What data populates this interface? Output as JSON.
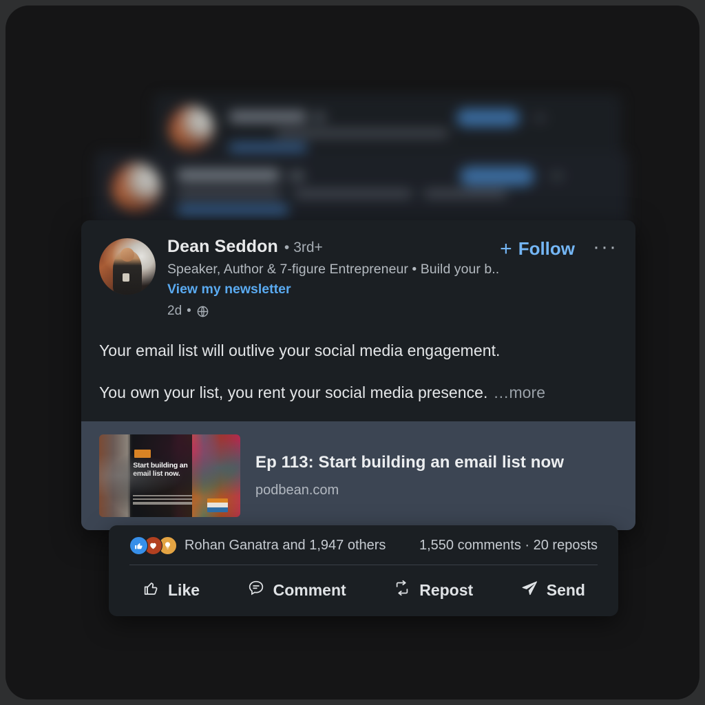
{
  "post": {
    "author": {
      "name": "Dean Seddon",
      "separator": "•",
      "degree": "3rd+",
      "headline": "Speaker, Author & 7-figure Entrepreneur • Build your b...",
      "newsletter_link": "View my newsletter",
      "timestamp": "2d",
      "meta_separator": "•",
      "visibility_icon": "globe-icon",
      "avatar_icon": "avatar"
    },
    "follow_button": {
      "plus": "+",
      "label": "Follow"
    },
    "more_menu": "···",
    "text_paragraphs": [
      "Your email list will outlive your social media engagement.",
      "You own your list, you rent your social media presence."
    ],
    "more_toggle": "…more",
    "link_preview": {
      "title": "Ep 113: Start building an email list now",
      "domain": "podbean.com",
      "thumbnail_text": "Start building an email list now."
    }
  },
  "social": {
    "reaction_icons": [
      "thumbs-up-icon",
      "heart-icon",
      "lightbulb-icon"
    ],
    "reaction_text": "Rohan Ganatra and 1,947 others",
    "counts_text": "1,550 comments · 20 reposts",
    "actions": [
      {
        "label": "Like",
        "icon": "thumbs-up-icon"
      },
      {
        "label": "Comment",
        "icon": "comment-bubble-icon"
      },
      {
        "label": "Repost",
        "icon": "repost-arrows-icon"
      },
      {
        "label": "Send",
        "icon": "send-paper-plane-icon"
      }
    ]
  },
  "colors": {
    "accent_blue": "#74b6f5",
    "link_blue": "#5aaaf0",
    "card_bg": "#1b1f23",
    "preview_bg": "#3c4553",
    "page_bg": "#151516",
    "reaction_like": "#378fe9",
    "reaction_love": "#b24020",
    "reaction_idea": "#e4a443"
  }
}
